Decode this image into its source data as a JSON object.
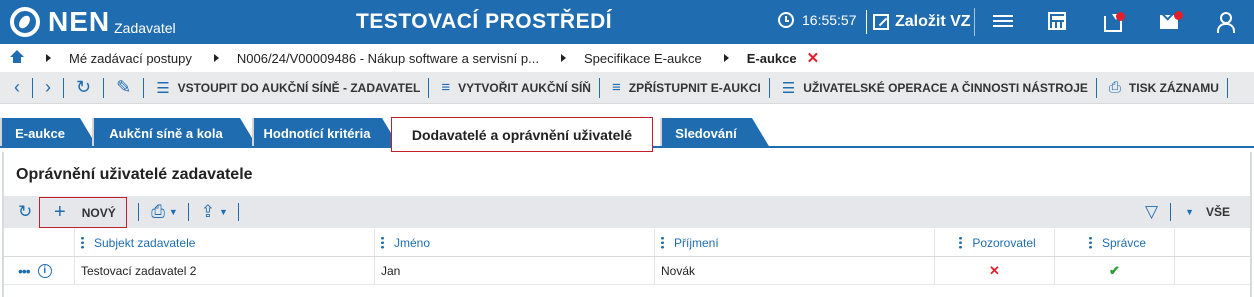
{
  "header": {
    "logo_text": "NEN",
    "logo_sub": "Zadavatel",
    "env_title": "TESTOVACÍ PROSTŘEDÍ",
    "time": "16:55:57",
    "create_vz_label": "Založit VZ"
  },
  "breadcrumb": {
    "items": [
      "Mé zadávací postupy",
      "N006/24/V00009486 - Nákup software a servisní p...",
      "Specifikace E-aukce",
      "E-aukce"
    ],
    "close_mark": "✕"
  },
  "toolbar": {
    "enter_room": "VSTOUPIT DO AUKČNÍ SÍNĚ - ZADAVATEL",
    "create_room": "VYTVOŘIT AUKČNÍ SÍŇ",
    "publish": "ZPŘÍSTUPNIT E-AUKCI",
    "user_ops": "UŽIVATELSKÉ OPERACE A ČINNOSTI NÁSTROJE",
    "print": "TISK ZÁZNAMU"
  },
  "tabs": [
    {
      "label": "E-aukce"
    },
    {
      "label": "Aukční síně a kola"
    },
    {
      "label": "Hodnotící kritéria"
    },
    {
      "label": "Dodavatelé a oprávnění uživatelé",
      "active": true
    },
    {
      "label": "Sledování"
    }
  ],
  "section": {
    "title": "Oprávnění uživatelé zadavatele",
    "new_label": "NOVÝ",
    "view_label": "VŠE"
  },
  "grid": {
    "columns": [
      "Subjekt zadavatele",
      "Jméno",
      "Příjmení",
      "Pozorovatel",
      "Správce"
    ],
    "rows": [
      {
        "subjekt": "Testovací zadavatel 2",
        "jmeno": "Jan",
        "prijmeni": "Novák",
        "pozorovatel": "✕",
        "spravce": "✔"
      }
    ]
  },
  "colors": {
    "primary": "#1f6db0",
    "highlight_border": "#c21f2b",
    "negative": "#e0212b",
    "positive": "#2d9c3c"
  }
}
